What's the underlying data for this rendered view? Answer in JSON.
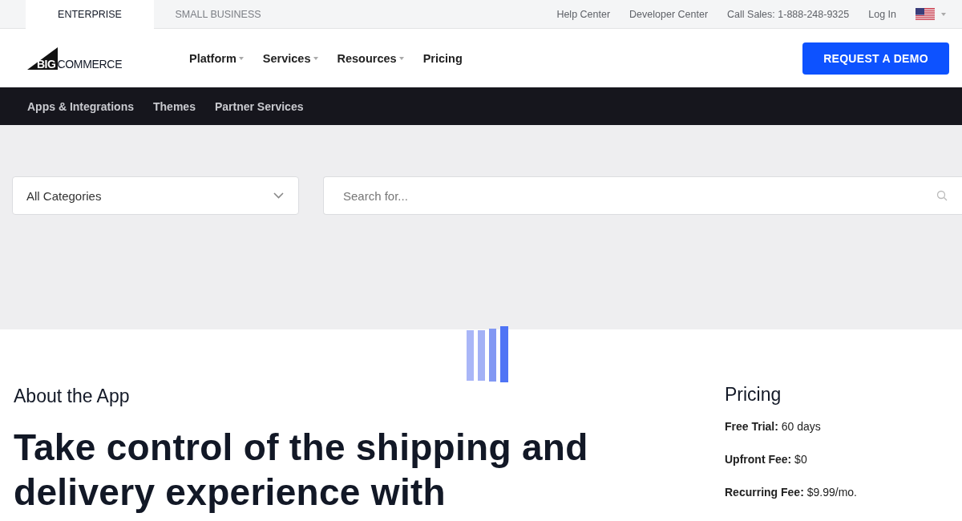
{
  "segment_tabs": [
    {
      "label": "ENTERPRISE",
      "selected": true
    },
    {
      "label": "SMALL BUSINESS",
      "selected": false
    }
  ],
  "utility_links": [
    "Help Center",
    "Developer Center",
    "Call Sales: 1-888-248-9325",
    "Log In"
  ],
  "logo": {
    "mark": "BIG",
    "word": "COMMERCE"
  },
  "main_nav": [
    {
      "label": "Platform",
      "dropdown": true
    },
    {
      "label": "Services",
      "dropdown": true
    },
    {
      "label": "Resources",
      "dropdown": true
    },
    {
      "label": "Pricing",
      "dropdown": false
    }
  ],
  "demo_button": "REQUEST A DEMO",
  "sub_nav": [
    "Apps & Integrations",
    "Themes",
    "Partner Services"
  ],
  "category_select": {
    "value": "All Categories"
  },
  "search": {
    "placeholder": "Search for..."
  },
  "about": {
    "title": "About the App",
    "headline": "Take control of the shipping and delivery experience with"
  },
  "pricing": {
    "title": "Pricing",
    "rows": [
      "**Free Trial:** 60 days",
      "**Upfront Fee:** $0",
      "**Recurring Fee:** $9.99/mo."
    ]
  }
}
